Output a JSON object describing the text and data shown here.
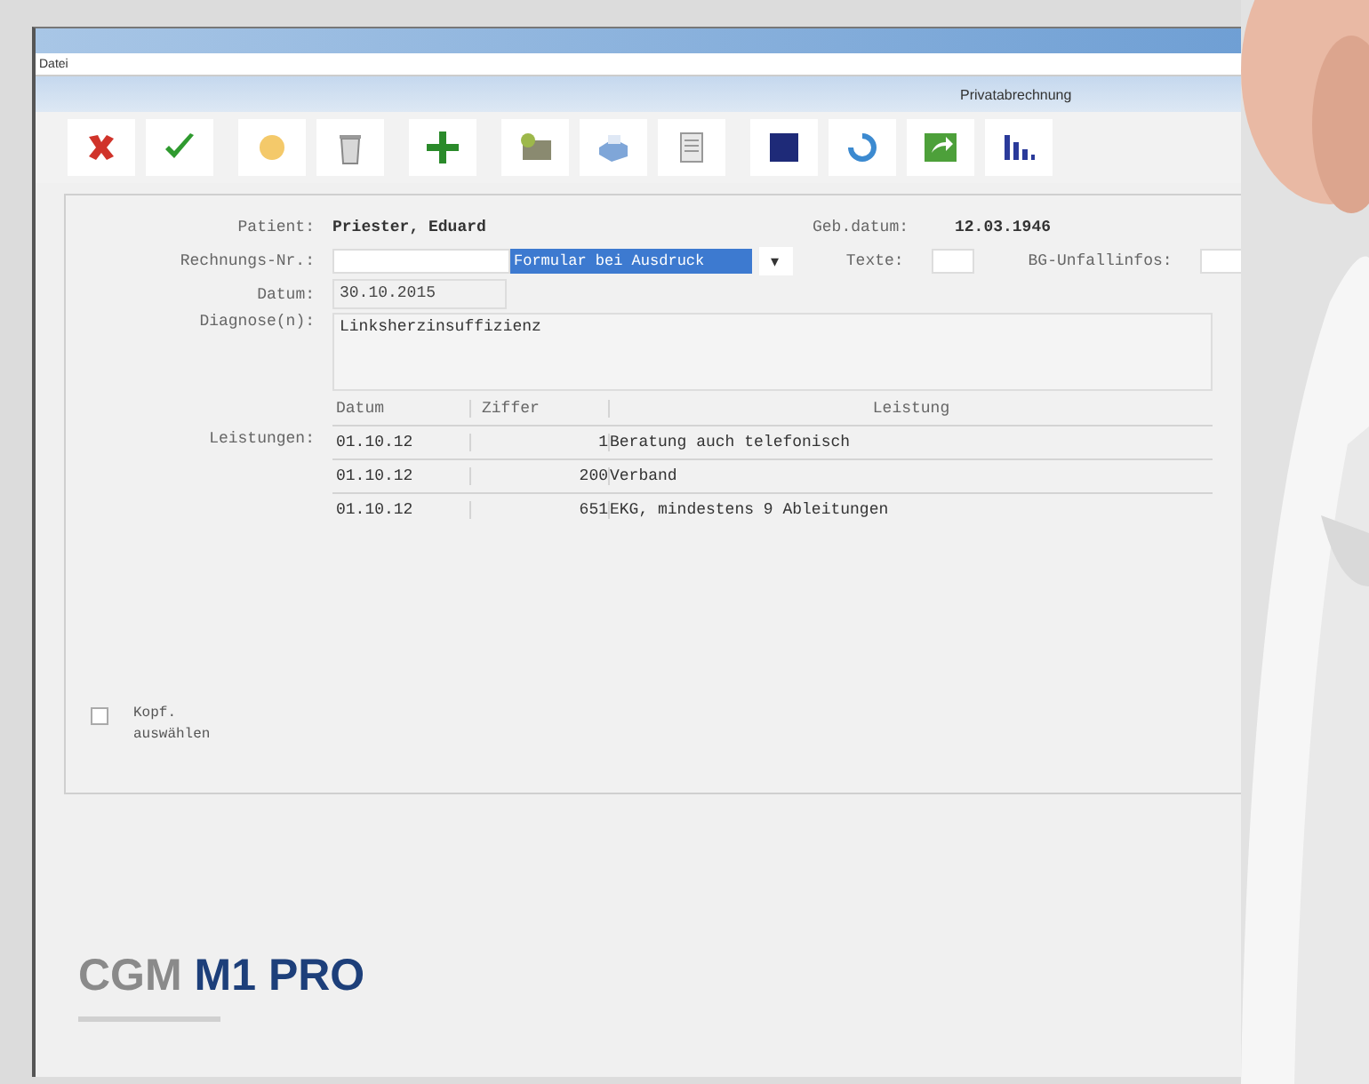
{
  "menu": [
    "Datei"
  ],
  "header": {
    "title": "Privatabrechnung"
  },
  "form": {
    "patient": {
      "label": "Patient:",
      "value": "Priester, Eduard"
    },
    "birth": {
      "label": "Geb.datum:",
      "value": "12.03.1946"
    },
    "invoice": {
      "label": "Rechnungs-Nr.:",
      "selection": "Formular bei Ausdruck",
      "arrow": "▾"
    },
    "texts": {
      "label": "Texte:"
    },
    "accident": {
      "label": "BG-Unfallinfos:"
    },
    "date": {
      "label": "Datum:",
      "value": "30.10.2015"
    },
    "diagnosis": {
      "label": "Diagnose(n):",
      "value": "Linksherzinsuffizienz"
    },
    "services": {
      "label": "Leistungen:",
      "columns": [
        "Datum",
        "Ziffer",
        "Leistung"
      ],
      "rows": [
        [
          "01.10.12",
          "1",
          "Beratung auch telefonisch"
        ],
        [
          "01.10.12",
          "200",
          "Verband"
        ],
        [
          "01.10.12",
          "651",
          "EKG, mindestens 9 Ableitungen"
        ]
      ]
    },
    "option": {
      "label": "Kopf. auswählen",
      "checked": false
    }
  },
  "logo": {
    "brand": "CGM",
    "product": "M1 PRO"
  }
}
